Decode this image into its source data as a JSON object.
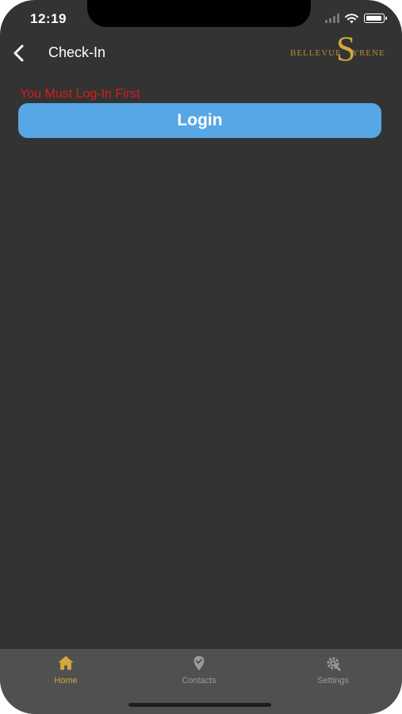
{
  "status_bar": {
    "time": "12:19"
  },
  "nav": {
    "title": "Check-In"
  },
  "logo": {
    "left_text": "BELLEVUE",
    "letter": "S",
    "right_text": "YRENE"
  },
  "content": {
    "warning": "You Must Log-In First",
    "login_label": "Login"
  },
  "tabs": [
    {
      "label": "Home",
      "icon": "home-icon",
      "active": true
    },
    {
      "label": "Contacts",
      "icon": "contacts-icon",
      "active": false
    },
    {
      "label": "Settings",
      "icon": "settings-icon",
      "active": false
    }
  ],
  "colors": {
    "background": "#333333",
    "accent_button": "#57a7e6",
    "warning": "#d81c1c",
    "active_tab": "#d5a73e",
    "inactive_tab": "#9a9a9a",
    "tab_bar": "#505050",
    "logo_gold": "#b58a2f"
  }
}
